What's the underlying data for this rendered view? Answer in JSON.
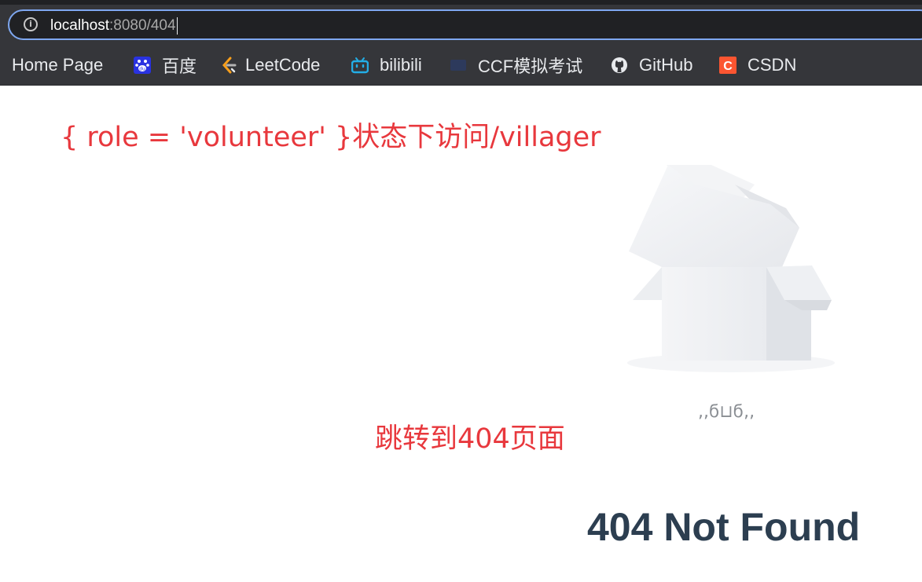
{
  "browser": {
    "url_host": "localhost",
    "url_path": ":8080/404",
    "bookmarks": [
      {
        "label": "Home Page",
        "icon": "chevron-icon"
      },
      {
        "label": "百度",
        "icon": "baidu-icon"
      },
      {
        "label": "LeetCode",
        "icon": "leetcode-icon"
      },
      {
        "label": "bilibili",
        "icon": "bilibili-icon"
      },
      {
        "label": "CCF模拟考试",
        "icon": "ccf-icon"
      },
      {
        "label": "GitHub",
        "icon": "github-icon"
      },
      {
        "label": "CSDN",
        "icon": "csdn-icon"
      }
    ]
  },
  "page": {
    "annotation_top": "{ role = 'volunteer' }状态下访问/villager",
    "annotation_mid": "跳转到404页面",
    "face_text": ",,ϭ⊔ϭ,,",
    "heading": "404 Not Found"
  },
  "colors": {
    "annotation": "#e8383d",
    "heading": "#2c3e50",
    "chrome": "#35363a",
    "omnibox_border": "#7ea7f0"
  }
}
